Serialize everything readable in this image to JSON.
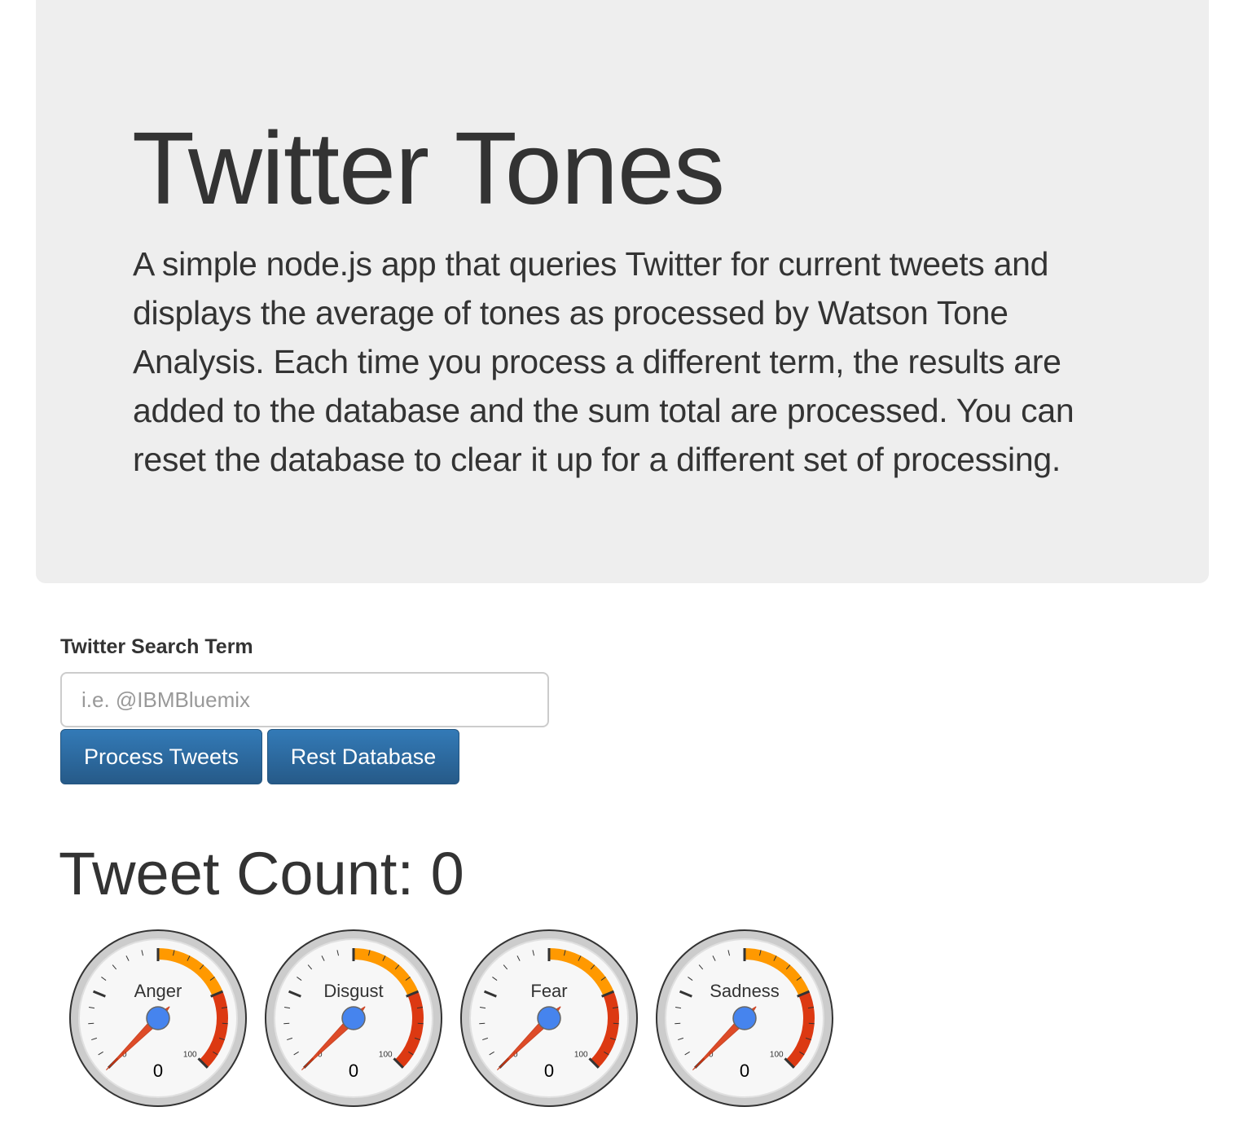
{
  "header": {
    "title": "Twitter Tones",
    "description": "A simple node.js app that queries Twitter for current tweets and displays the average of tones as processed by Watson Tone Analysis. Each time you process a different term, the results are added to the database and the sum total are processed. You can reset the database to clear it up for a different set of processing."
  },
  "form": {
    "label": "Twitter Search Term",
    "placeholder": "i.e. @IBMBluemix",
    "value": "",
    "process_button": "Process Tweets",
    "reset_button": "Rest Database"
  },
  "tweet_count": {
    "label": "Tweet Count: 0"
  },
  "colors": {
    "warning_band": "#ff9900",
    "danger_band": "#dc3912",
    "needle": "#dc3912",
    "hub": "#4684ee",
    "primary_button": "#337ab7"
  },
  "gauges": [
    {
      "label": "Anger",
      "value": 0,
      "min_label": "0",
      "max_label": "100",
      "value_text": "0"
    },
    {
      "label": "Disgust",
      "value": 0,
      "min_label": "0",
      "max_label": "100",
      "value_text": "0"
    },
    {
      "label": "Fear",
      "value": 0,
      "min_label": "0",
      "max_label": "100",
      "value_text": "0"
    },
    {
      "label": "Sadness",
      "value": 0,
      "min_label": "0",
      "max_label": "100",
      "value_text": "0"
    }
  ]
}
